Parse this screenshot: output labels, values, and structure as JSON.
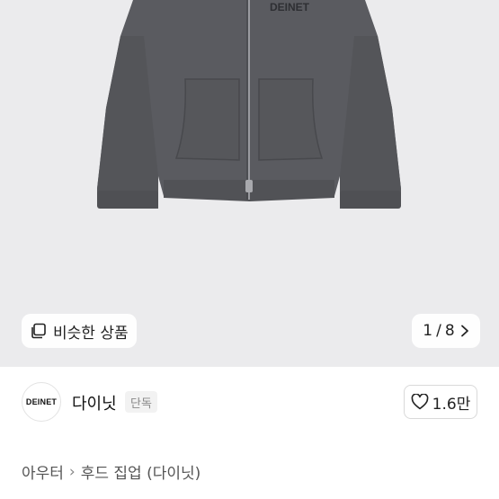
{
  "hero": {
    "product_image": "charcoal-zip-up-hoodie",
    "print_text": "DEINET",
    "similar_button_label": "비슷한 상품",
    "similar_icon": "stacked-squares-icon",
    "pager": {
      "current": "1",
      "separator": "/",
      "total": "8"
    },
    "pager_icon": "chevron-right-icon",
    "background_color": "#ebebed",
    "garment_color": "#5a5b60"
  },
  "shop": {
    "logo_text": "DEINET",
    "name": "다이닛",
    "badge": "단독",
    "like_icon": "heart-outline-icon",
    "like_count": "1.6만"
  },
  "breadcrumb": {
    "category": "아우터",
    "separator_icon": "chevron-right-icon",
    "subcategory": "후드 집업 (다이닛)"
  }
}
